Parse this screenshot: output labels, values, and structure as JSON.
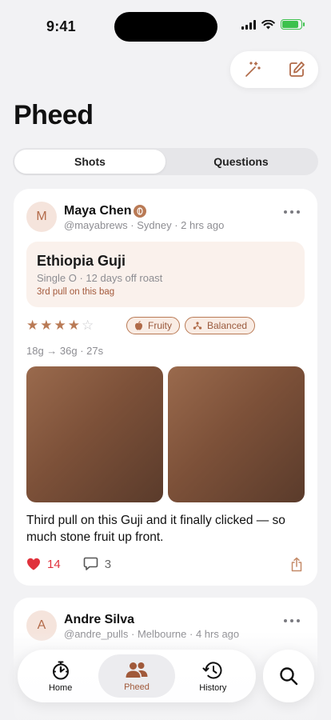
{
  "status": {
    "time": "9:41"
  },
  "page": {
    "title": "Pheed"
  },
  "segments": [
    {
      "label": "Shots",
      "active": true
    },
    {
      "label": "Questions",
      "active": false
    }
  ],
  "posts": [
    {
      "author_initial": "M",
      "author": "Maya Chen",
      "meta": "@mayabrews · Sydney · 2 hrs ago",
      "bean": "Ethiopia Guji",
      "bean_sub": "Single O · 12 days off roast",
      "pull": "3rd pull on this bag",
      "rating": 4,
      "rating_max": 5,
      "tags": [
        "Fruity",
        "Balanced"
      ],
      "recipe": "18g → 36g · 27s",
      "caption": "Third pull on this Guji and it finally clicked — so much stone fruit up front.",
      "likes": "14",
      "comments": "3"
    },
    {
      "author_initial": "A",
      "author": "Andre Silva",
      "meta": "@andre_pulls · Melbourne · 4 hrs ago"
    }
  ],
  "tabbar": {
    "items": [
      {
        "label": "Home",
        "icon": "timer-icon"
      },
      {
        "label": "Pheed",
        "icon": "people-icon",
        "active": true
      },
      {
        "label": "History",
        "icon": "history-icon"
      }
    ],
    "search_icon": "search-icon"
  },
  "colors": {
    "accent": "#a0593a",
    "like": "#e0323c",
    "battery": "#3cc14c"
  }
}
